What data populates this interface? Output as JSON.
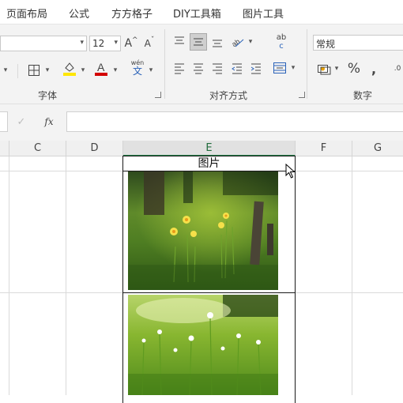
{
  "tabs": [
    "页面布局",
    "公式",
    "方方格子",
    "DIY工具箱",
    "图片工具"
  ],
  "ribbon": {
    "font_group_label": "字体",
    "align_group_label": "对齐方式",
    "number_group_label": "数字",
    "font_size": "12",
    "number_format": "常规",
    "wen_glyph_top": "wén",
    "wen_glyph_bottom": "文",
    "ab_glyph_top": "ab",
    "ab_glyph_bottom": "c",
    "percent": "%",
    "font_color": "#d40000",
    "fill_color": "#ffe600"
  },
  "formula_bar": {
    "fx": "fx",
    "value": ""
  },
  "sheet": {
    "columns": [
      "C",
      "D",
      "E",
      "F",
      "G"
    ],
    "selected_column": "E",
    "e1_text": "图片"
  },
  "images": [
    "photo-daffodils-meadow",
    "photo-white-wildflowers"
  ]
}
